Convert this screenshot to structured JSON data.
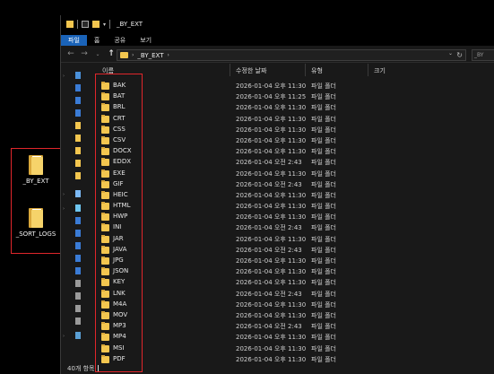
{
  "desktop": {
    "icons": [
      {
        "label": "_BY_EXT"
      },
      {
        "label": "_SORT_LOGS"
      }
    ]
  },
  "window": {
    "title": "_BY_EXT",
    "ribbon_tabs": [
      "파일",
      "홈",
      "공유",
      "보기"
    ],
    "address": {
      "crumb": "_BY_EXT",
      "search_placeholder": "_BY"
    },
    "columns": {
      "name": "이름",
      "date": "수정한 날짜",
      "type": "유형",
      "size": "크기"
    },
    "rows": [
      {
        "name": "BAK",
        "date": "2026-01-04 오후 11:30",
        "type": "파일 폴더"
      },
      {
        "name": "BAT",
        "date": "2026-01-04 오후 11:25",
        "type": "파일 폴더"
      },
      {
        "name": "BRL",
        "date": "2026-01-04 오후 11:30",
        "type": "파일 폴더"
      },
      {
        "name": "CRT",
        "date": "2026-01-04 오후 11:30",
        "type": "파일 폴더"
      },
      {
        "name": "CSS",
        "date": "2026-01-04 오후 11:30",
        "type": "파일 폴더"
      },
      {
        "name": "CSV",
        "date": "2026-01-04 오후 11:30",
        "type": "파일 폴더"
      },
      {
        "name": "DOCX",
        "date": "2026-01-04 오후 11:30",
        "type": "파일 폴더"
      },
      {
        "name": "EDDX",
        "date": "2026-01-04 오전 2:43",
        "type": "파일 폴더"
      },
      {
        "name": "EXE",
        "date": "2026-01-04 오후 11:30",
        "type": "파일 폴더"
      },
      {
        "name": "GIF",
        "date": "2026-01-04 오전 2:43",
        "type": "파일 폴더"
      },
      {
        "name": "HEIC",
        "date": "2026-01-04 오후 11:30",
        "type": "파일 폴더"
      },
      {
        "name": "HTML",
        "date": "2026-01-04 오후 11:30",
        "type": "파일 폴더"
      },
      {
        "name": "HWP",
        "date": "2026-01-04 오후 11:30",
        "type": "파일 폴더"
      },
      {
        "name": "INI",
        "date": "2026-01-04 오전 2:43",
        "type": "파일 폴더"
      },
      {
        "name": "JAR",
        "date": "2026-01-04 오후 11:30",
        "type": "파일 폴더"
      },
      {
        "name": "JAVA",
        "date": "2026-01-04 오전 2:43",
        "type": "파일 폴더"
      },
      {
        "name": "JPG",
        "date": "2026-01-04 오후 11:30",
        "type": "파일 폴더"
      },
      {
        "name": "JSON",
        "date": "2026-01-04 오후 11:30",
        "type": "파일 폴더"
      },
      {
        "name": "KEY",
        "date": "2026-01-04 오후 11:30",
        "type": "파일 폴더"
      },
      {
        "name": "LNK",
        "date": "2026-01-04 오전 2:43",
        "type": "파일 폴더"
      },
      {
        "name": "M4A",
        "date": "2026-01-04 오후 11:30",
        "type": "파일 폴더"
      },
      {
        "name": "MOV",
        "date": "2026-01-04 오후 11:30",
        "type": "파일 폴더"
      },
      {
        "name": "MP3",
        "date": "2026-01-04 오전 2:43",
        "type": "파일 폴더"
      },
      {
        "name": "MP4",
        "date": "2026-01-04 오후 11:30",
        "type": "파일 폴더"
      },
      {
        "name": "MSI",
        "date": "2026-01-04 오후 11:30",
        "type": "파일 폴더"
      },
      {
        "name": "PDF",
        "date": "2026-01-04 오후 11:30",
        "type": "파일 폴더"
      }
    ],
    "status": "40개 항목"
  },
  "colors": {
    "highlight_box": "#e0262b",
    "ribbon_active": "#1a63b8",
    "folder": "#f3c64f"
  }
}
